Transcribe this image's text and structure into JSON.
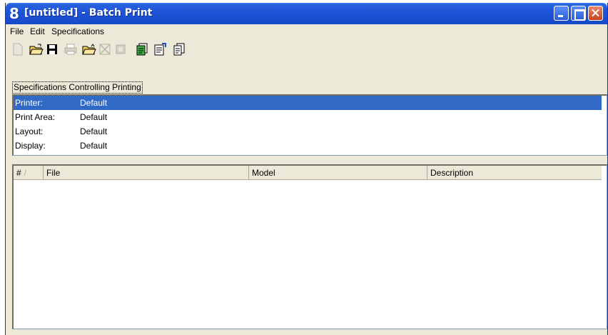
{
  "window": {
    "title": "[untitled] - Batch Print",
    "app_icon_glyph": "8",
    "title_color": "#1f55d8",
    "selection_color": "#316ac5"
  },
  "menu": {
    "items": [
      "File",
      "Edit",
      "Specifications"
    ]
  },
  "toolbar": {
    "buttons": [
      {
        "name": "new-icon",
        "enabled": false
      },
      {
        "name": "open-icon",
        "enabled": true
      },
      {
        "name": "save-icon",
        "enabled": true
      },
      {
        "name": "print-icon",
        "enabled": false
      },
      {
        "name": "open-folder-icon",
        "enabled": true
      },
      {
        "name": "delete-icon",
        "enabled": false
      },
      {
        "name": "disabled-doc-icon",
        "enabled": false
      },
      {
        "name": "green-doc-icon",
        "enabled": true
      },
      {
        "name": "properties-doc-icon",
        "enabled": true
      },
      {
        "name": "multi-doc-icon",
        "enabled": true
      }
    ]
  },
  "specs": {
    "label": "Specifications Controlling Printing",
    "rows": [
      {
        "key": "Printer:",
        "value": "Default",
        "selected": true
      },
      {
        "key": "Print Area:",
        "value": "Default",
        "selected": false
      },
      {
        "key": "Layout:",
        "value": "Default",
        "selected": false
      },
      {
        "key": "Display:",
        "value": "Default",
        "selected": false
      }
    ]
  },
  "file_list": {
    "columns": {
      "number": "#",
      "sort_indicator": "/",
      "file": "File",
      "model": "Model",
      "description": "Description"
    },
    "rows": []
  }
}
